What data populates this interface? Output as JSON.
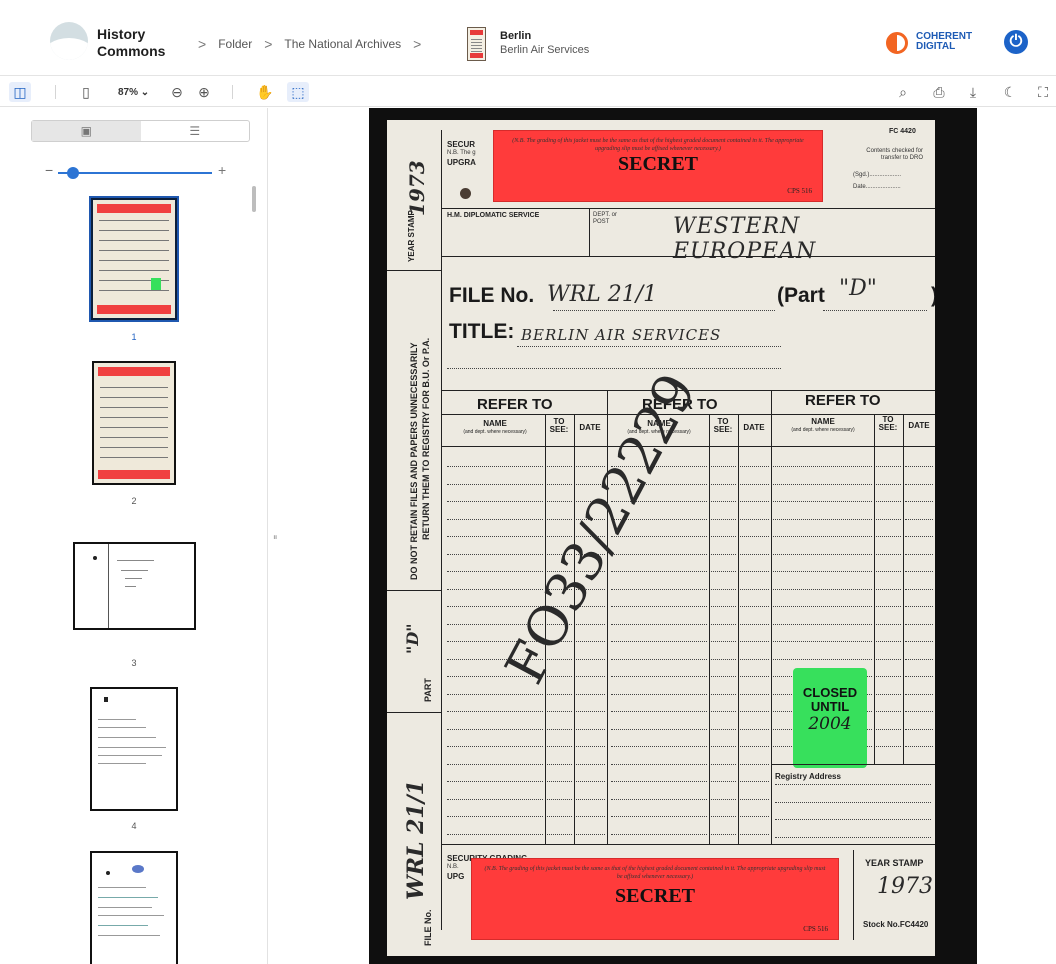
{
  "header": {
    "brand_line1": "History",
    "brand_line2": "Commons",
    "breadcrumbs": [
      "Folder",
      "The National Archives"
    ],
    "sep": ">",
    "doc_title": "Berlin",
    "doc_subtitle": "Berlin Air Services",
    "partner_line1": "COHERENT",
    "partner_line2": "DIGITAL",
    "power_icon": "power-icon"
  },
  "toolbar": {
    "zoom_label": "87% ⌄",
    "icons": [
      "sidebar-toggle-icon",
      "page-fit-icon",
      "zoom-out-icon",
      "zoom-in-icon",
      "hand-tool-icon",
      "select-tool-icon",
      "search-icon",
      "print-icon",
      "download-icon",
      "dark-mode-icon",
      "fullscreen-icon"
    ]
  },
  "sidebar": {
    "views": [
      "thumbnails-view-icon",
      "outline-view-icon"
    ],
    "slider_minus": "−",
    "slider_plus": "+",
    "slider_value": 0.08,
    "thumbnails": [
      {
        "label": "1",
        "selected": true
      },
      {
        "label": "2",
        "selected": false
      },
      {
        "label": "3",
        "selected": false
      },
      {
        "label": "4",
        "selected": false
      },
      {
        "label": "",
        "selected": false
      }
    ]
  },
  "document": {
    "top_label": {
      "note": "(N.B. The grading of this jacket must be the same as that of the highest graded document contained in it. The appropriate upgrading slip must be affixed whenever necessary.)",
      "word": "SECRET",
      "code": "CPS 516"
    },
    "security_label": "SECUR",
    "nb_label": "N.B. The g",
    "upgrade_label": "UPGRA",
    "form_code": "FC 4420",
    "contents_checked": "Contents checked for transfer to DRO",
    "sgd": "(Sgd.)...................",
    "date": "Date.....................",
    "year_stamp_side": "YEAR STAMP",
    "year_hand": "1973",
    "service": "H.M. DIPLOMATIC SERVICE",
    "dept_label": "DEPT. or POST",
    "dept_hand": "WESTERN EUROPEAN",
    "file_no_label": "FILE No.",
    "file_no_hand": "WRL 21/1",
    "part_label": "(Part",
    "part_hand": "\"D\"",
    "part_close": ")",
    "title_label": "TITLE:",
    "title_hand": "BERLIN AIR SERVICES",
    "side_warning_1": "DO NOT RETAIN FILES AND PAPERS UNNECESSARILY",
    "side_warning_2": "RETURN THEM TO REGISTRY FOR B.U. Or P.A.",
    "refer_to": "REFER TO",
    "col_name": "NAME",
    "col_name_sub": "(and dept. where necessary)",
    "col_to": "TO",
    "col_see": "SEE:",
    "col_date": "DATE",
    "reference_hand": "FO33/22229",
    "closed_line1": "CLOSED",
    "closed_line2": "UNTIL",
    "closed_year": "2004",
    "registry": "Registry Address",
    "part_side": "PART",
    "part_side_hand": "\"D\"",
    "file_no_side": "FILE No.",
    "file_no_side_hand": "WRL 21/1",
    "bottom_security": "SECURITY GRADING",
    "bottom_nb": "N.B.",
    "bottom_upg": "UPG",
    "year_stamp": "YEAR STAMP",
    "year_stamp_hand": "1973",
    "stock_no": "Stock No.FC4420"
  },
  "colors": {
    "accent": "#2c74d4",
    "secret_red": "#ff3b3b",
    "closed_green": "#37e05c",
    "partner_orange": "#f26522"
  }
}
